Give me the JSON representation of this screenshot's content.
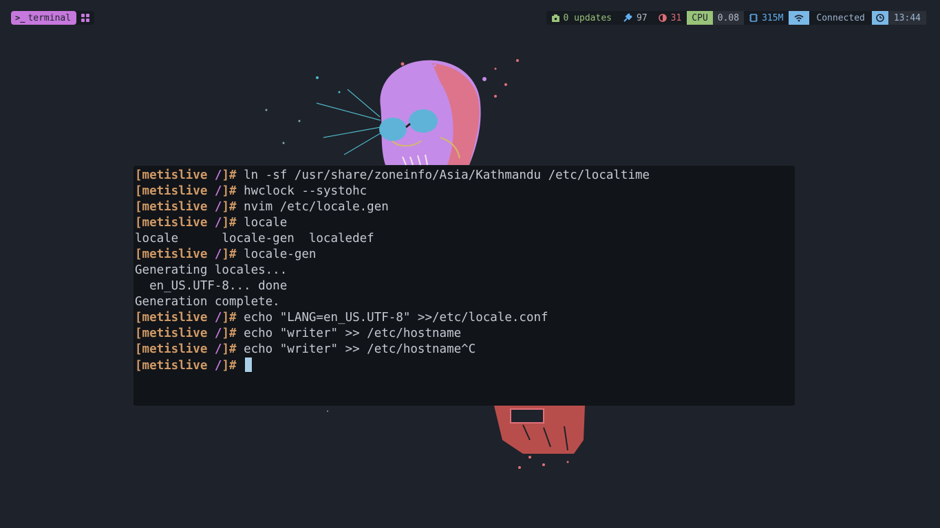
{
  "workspace": {
    "active_label": "terminal",
    "active_icon": "terminal-icon",
    "grid_icon": "apps-grid-icon"
  },
  "status": {
    "updates": "0 updates",
    "brightness": "97",
    "battery": "31",
    "cpu_label": "CPU",
    "cpu_value": "0.08",
    "memory": "315M",
    "network": "Connected",
    "clock": "13:44"
  },
  "colors": {
    "accent": "#c678dd",
    "prompt": "#d19a66",
    "green": "#98c379",
    "blue": "#7ab8e8",
    "red": "#e06c75",
    "terminal_bg": "#111419",
    "desktop_bg": "#1e222a"
  },
  "terminal": {
    "prompt_user": "[metislive ",
    "prompt_path": "/",
    "prompt_end": "]# ",
    "lines": [
      {
        "type": "cmd",
        "text": "ln -sf /usr/share/zoneinfo/Asia/Kathmandu /etc/localtime"
      },
      {
        "type": "cmd",
        "text": "hwclock --systohc"
      },
      {
        "type": "cmd",
        "text": "nvim /etc/locale.gen"
      },
      {
        "type": "cmd",
        "text": "locale"
      },
      {
        "type": "out",
        "text": "locale      locale-gen  localedef"
      },
      {
        "type": "cmd",
        "text": "locale-gen"
      },
      {
        "type": "out",
        "text": "Generating locales..."
      },
      {
        "type": "out",
        "text": "  en_US.UTF-8... done"
      },
      {
        "type": "out",
        "text": "Generation complete."
      },
      {
        "type": "cmd",
        "text": "echo \"LANG=en_US.UTF-8\" >>/etc/locale.conf"
      },
      {
        "type": "cmd",
        "text": "echo \"writer\" >> /etc/hostname"
      },
      {
        "type": "cmd",
        "text": "echo \"writer\" >> /etc/hostname^C"
      },
      {
        "type": "cmd",
        "text": "",
        "cursor": true
      }
    ]
  }
}
